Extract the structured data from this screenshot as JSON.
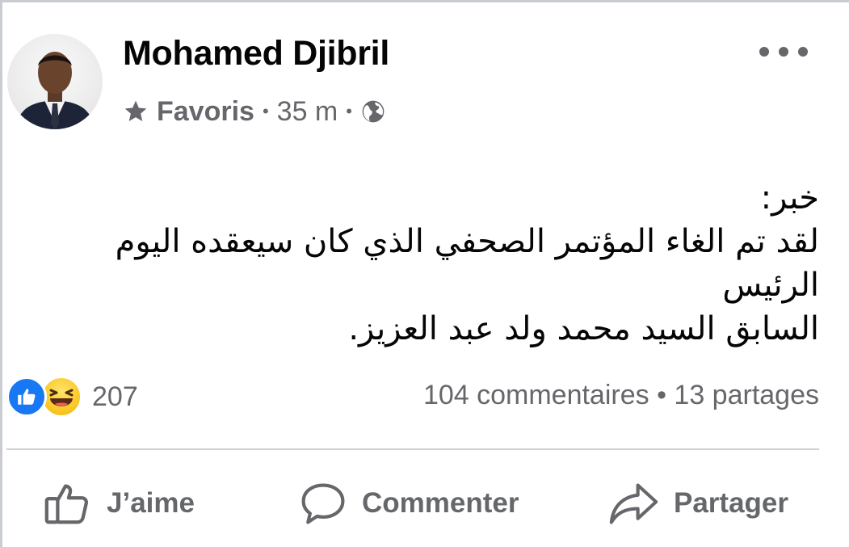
{
  "post": {
    "author": "Mohamed Djibril",
    "audience_label": "Favoris",
    "separator": "•",
    "time": "35 m",
    "lines": [
      "خبر:",
      "لقد تم الغاء المؤتمر الصحفي الذي كان سيعقده اليوم الرئيس",
      "السابق السيد محمد ولد عبد العزيز."
    ]
  },
  "engagement": {
    "reaction_count": "207",
    "stats": "104 commentaires • 13 partages"
  },
  "actions": {
    "like": "J’aime",
    "comment": "Commenter",
    "share": "Partager"
  },
  "colors": {
    "brand_blue": "#1877f2",
    "secondary_text": "#65676b",
    "primary_text": "#050505",
    "divider": "#ced0d4"
  },
  "icons": {
    "audience": "star-icon",
    "privacy": "globe-icon",
    "more": "more-options-icon",
    "reaction_1": "like-reaction-icon",
    "reaction_2": "haha-reaction-icon",
    "like": "thumbs-up-icon",
    "comment": "speech-bubble-icon",
    "share": "share-arrow-icon"
  }
}
